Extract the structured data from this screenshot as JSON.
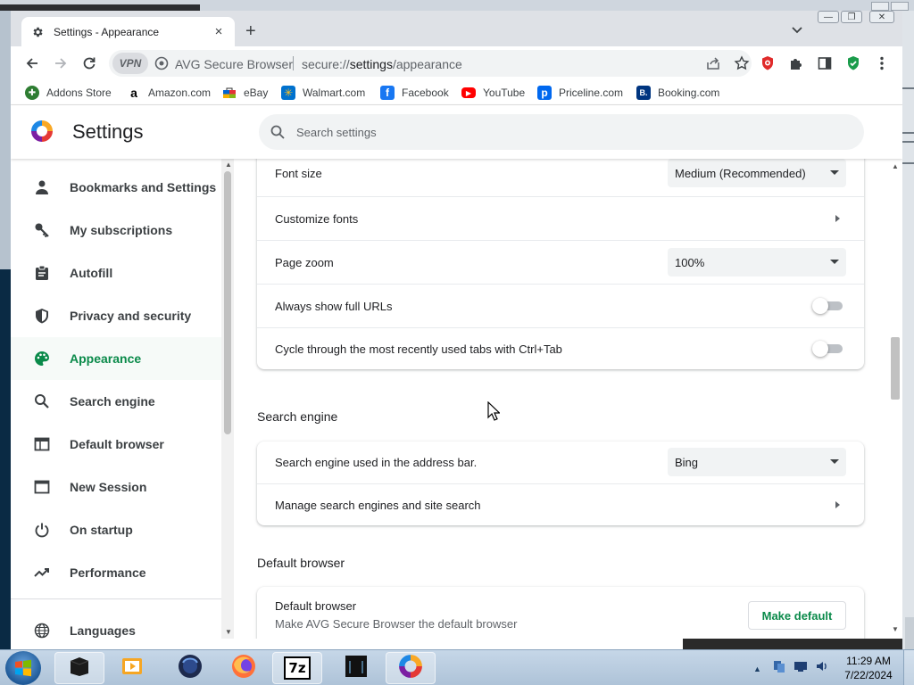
{
  "tab": {
    "title": "Settings - Appearance",
    "close": "×"
  },
  "newtab": "+",
  "window_controls": {
    "minimize": "—",
    "restore": "❐",
    "close": "✕"
  },
  "omnibox": {
    "vpn": "VPN",
    "browser_name": "AVG Secure Browser",
    "url_prefix": "secure://",
    "url_path": "settings",
    "url_suffix": "/appearance"
  },
  "bookmarks": [
    {
      "label": "Addons Store",
      "color": "#2e7d32",
      "glyph": "✚"
    },
    {
      "label": "Amazon.com",
      "color": "#ffffff",
      "glyph": "a"
    },
    {
      "label": "eBay",
      "color": "#e53238",
      "glyph": ""
    },
    {
      "label": "Walmart.com",
      "color": "#0071ce",
      "glyph": "✳"
    },
    {
      "label": "Facebook",
      "color": "#1877f2",
      "glyph": "f"
    },
    {
      "label": "YouTube",
      "color": "#ff0000",
      "glyph": "▶"
    },
    {
      "label": "Priceline.com",
      "color": "#0068ef",
      "glyph": "p"
    },
    {
      "label": "Booking.com",
      "color": "#003580",
      "glyph": "B."
    }
  ],
  "settings": {
    "title": "Settings",
    "search_placeholder": "Search settings"
  },
  "sidebar": {
    "items": [
      {
        "label": "Bookmarks and Settings",
        "icon": "person-icon",
        "active": false
      },
      {
        "label": "My subscriptions",
        "icon": "key-icon",
        "active": false
      },
      {
        "label": "Autofill",
        "icon": "clipboard-icon",
        "active": false
      },
      {
        "label": "Privacy and security",
        "icon": "shield-icon",
        "active": false
      },
      {
        "label": "Appearance",
        "icon": "palette-icon",
        "active": true
      },
      {
        "label": "Search engine",
        "icon": "search-icon",
        "active": false
      },
      {
        "label": "Default browser",
        "icon": "browser-icon",
        "active": false
      },
      {
        "label": "New Session",
        "icon": "window-icon",
        "active": false
      },
      {
        "label": "On startup",
        "icon": "power-icon",
        "active": false
      },
      {
        "label": "Performance",
        "icon": "trend-icon",
        "active": false
      },
      {
        "label": "Languages",
        "icon": "globe-icon",
        "active": false
      }
    ]
  },
  "appearance": {
    "font_size": {
      "label": "Font size",
      "value": "Medium (Recommended)"
    },
    "customize_fonts": {
      "label": "Customize fonts"
    },
    "page_zoom": {
      "label": "Page zoom",
      "value": "100%"
    },
    "full_urls": {
      "label": "Always show full URLs",
      "enabled": false
    },
    "cycle_tabs": {
      "label": "Cycle through the most recently used tabs with Ctrl+Tab",
      "enabled": false
    }
  },
  "search_engine": {
    "heading": "Search engine",
    "address_bar": {
      "label": "Search engine used in the address bar.",
      "value": "Bing"
    },
    "manage": {
      "label": "Manage search engines and site search"
    }
  },
  "default_browser": {
    "heading": "Default browser",
    "title": "Default browser",
    "subtitle": "Make AVG Secure Browser the default browser",
    "button": "Make default"
  },
  "taskbar": {
    "apps": [
      "terminal",
      "media-player",
      "firefox-alt",
      "firefox",
      "7zip",
      "monitor",
      "avg-browser"
    ],
    "seven_zip_label": "7z",
    "time": "11:29 AM",
    "date": "7/22/2024"
  },
  "colors": {
    "accent": "#0a8a4a",
    "active_bg": "#f6faf8"
  }
}
